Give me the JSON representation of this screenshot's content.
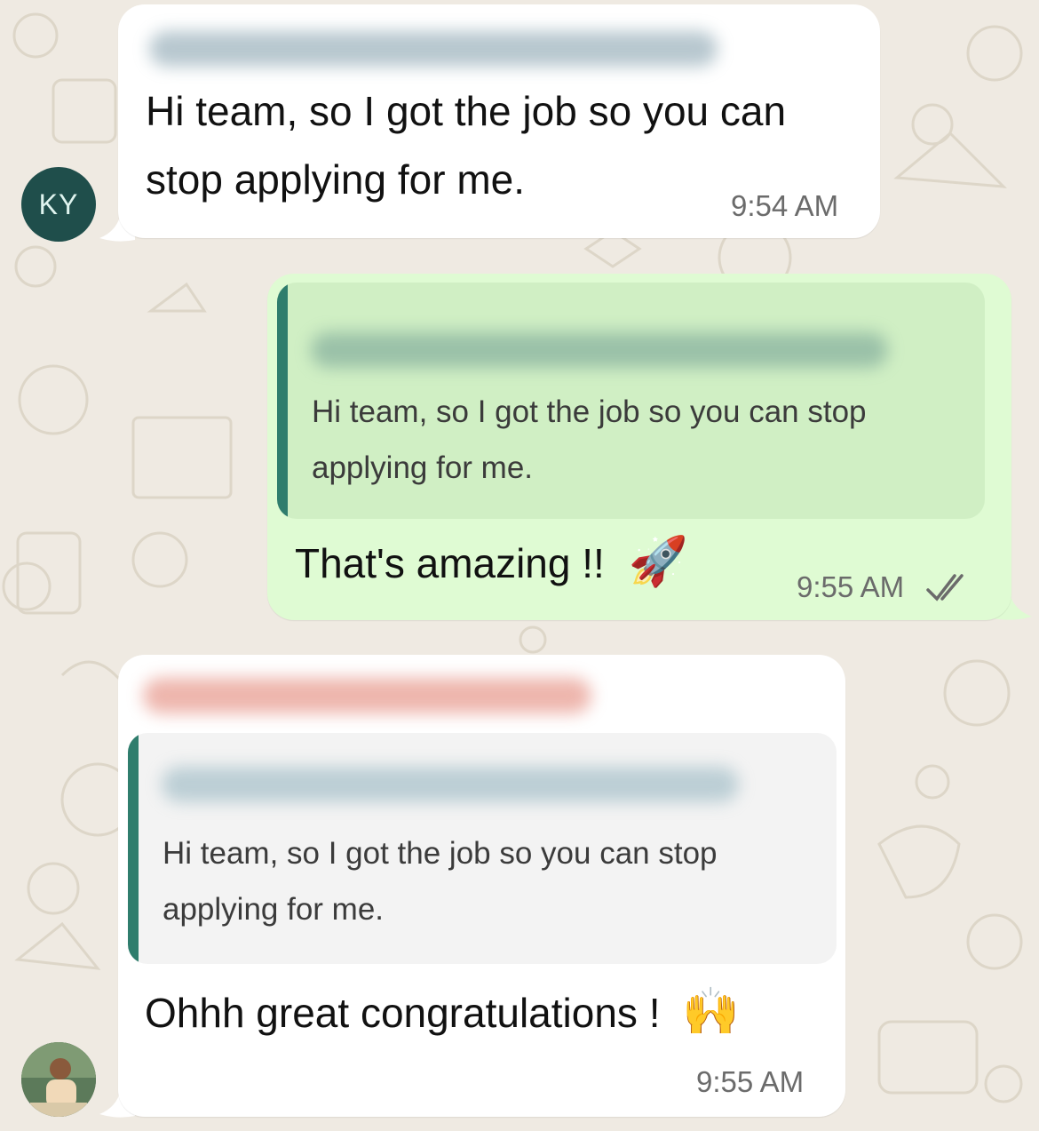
{
  "messages": [
    {
      "direction": "incoming",
      "avatar_initials": "KY",
      "text_line1": "Hi team, so I got the job so you can",
      "text_line2": "stop applying for me.",
      "time": "9:54 AM"
    },
    {
      "direction": "outgoing",
      "quote_line1": "Hi team, so I got the job so you can stop",
      "quote_line2": "applying for me.",
      "text": "That's amazing !!",
      "emoji": "🚀",
      "time": "9:55 AM",
      "status_icon": "double-check-icon"
    },
    {
      "direction": "incoming",
      "quote_line1": "Hi team, so I got the job so you can stop",
      "quote_line2": "applying for me.",
      "text": "Ohhh great congratulations !",
      "emoji": "🙌",
      "time": "9:55 AM"
    }
  ],
  "colors": {
    "incoming_bubble": "#ffffff",
    "outgoing_bubble": "#dffbd3",
    "quote_bar": "#2f7d6d",
    "wallpaper": "#efeae2"
  }
}
